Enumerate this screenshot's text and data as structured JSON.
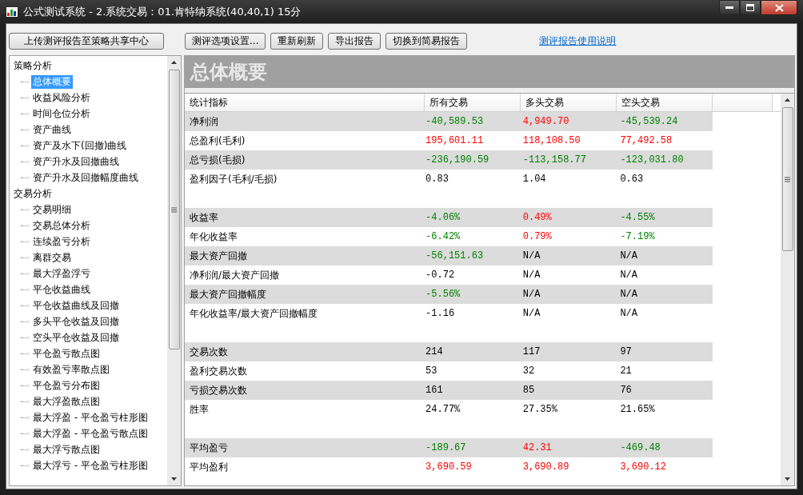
{
  "window": {
    "title": "公式测试系统 - 2.系统交易：01.肯特纳系统(40,40,1) 15分"
  },
  "toolbar": {
    "buttons": [
      {
        "label": "上传测评报告至策略共享中心",
        "kind": "wide"
      },
      {
        "label": "测评选项设置...",
        "kind": "normal"
      },
      {
        "label": "重新刷新",
        "kind": "normal"
      },
      {
        "label": "导出报告",
        "kind": "normal"
      },
      {
        "label": "切换到简易报告",
        "kind": "normal"
      }
    ],
    "link": "测评报告使用说明"
  },
  "tree": [
    {
      "label": "策略分析",
      "children": [
        {
          "label": "总体概要",
          "selected": true
        },
        {
          "label": "收益风险分析",
          "selected": false
        },
        {
          "label": "时间仓位分析",
          "selected": false
        },
        {
          "label": "资产曲线",
          "selected": false
        },
        {
          "label": "资产及水下(回撤)曲线",
          "selected": false
        },
        {
          "label": "资产升水及回撤曲线",
          "selected": false
        },
        {
          "label": "资产升水及回撤幅度曲线",
          "selected": false
        }
      ]
    },
    {
      "label": "交易分析",
      "children": [
        {
          "label": "交易明细",
          "selected": false
        },
        {
          "label": "交易总体分析",
          "selected": false
        },
        {
          "label": "连续盈亏分析",
          "selected": false
        },
        {
          "label": "离群交易",
          "selected": false
        },
        {
          "label": "最大浮盈浮亏",
          "selected": false
        },
        {
          "label": "平仓收益曲线",
          "selected": false
        },
        {
          "label": "平仓收益曲线及回撤",
          "selected": false
        },
        {
          "label": "多头平仓收益及回撤",
          "selected": false
        },
        {
          "label": "空头平仓收益及回撤",
          "selected": false
        },
        {
          "label": "平仓盈亏散点图",
          "selected": false
        },
        {
          "label": "有效盈亏率散点图",
          "selected": false
        },
        {
          "label": "平仓盈亏分布图",
          "selected": false
        },
        {
          "label": "最大浮盈散点图",
          "selected": false
        },
        {
          "label": "最大浮盈 - 平仓盈亏柱形图",
          "selected": false
        },
        {
          "label": "最大浮盈 - 平仓盈亏散点图",
          "selected": false
        },
        {
          "label": "最大浮亏散点图",
          "selected": false
        },
        {
          "label": "最大浮亏 - 平仓盈亏柱形图",
          "selected": false
        }
      ]
    }
  ],
  "section_title": "总体概要",
  "table": {
    "columns": [
      "统计指标",
      "所有交易",
      "多头交易",
      "空头交易"
    ],
    "groups": [
      [
        {
          "label": "净利润",
          "cells": [
            {
              "text": "-40,589.53",
              "color": "#008000"
            },
            {
              "text": "4,949.70",
              "color": "#ff0000"
            },
            {
              "text": "-45,539.24",
              "color": "#008000"
            }
          ]
        },
        {
          "label": "总盈利(毛利)",
          "cells": [
            {
              "text": "195,601.11",
              "color": "#ff0000"
            },
            {
              "text": "118,108.50",
              "color": "#ff0000"
            },
            {
              "text": "77,492.58",
              "color": "#ff0000"
            }
          ]
        },
        {
          "label": "总亏损(毛损)",
          "cells": [
            {
              "text": "-236,190.59",
              "color": "#008000"
            },
            {
              "text": "-113,158.77",
              "color": "#008000"
            },
            {
              "text": "-123,031.80",
              "color": "#008000"
            }
          ]
        },
        {
          "label": "盈利因子(毛利/毛损)",
          "cells": [
            {
              "text": "0.83",
              "color": "#000000"
            },
            {
              "text": "1.04",
              "color": "#000000"
            },
            {
              "text": "0.63",
              "color": "#000000"
            }
          ]
        }
      ],
      [
        {
          "label": "收益率",
          "cells": [
            {
              "text": "-4.06%",
              "color": "#008000"
            },
            {
              "text": "0.49%",
              "color": "#ff0000"
            },
            {
              "text": "-4.55%",
              "color": "#008000"
            }
          ]
        },
        {
          "label": "年化收益率",
          "cells": [
            {
              "text": "-6.42%",
              "color": "#008000"
            },
            {
              "text": "0.79%",
              "color": "#ff0000"
            },
            {
              "text": "-7.19%",
              "color": "#008000"
            }
          ]
        },
        {
          "label": "最大资产回撤",
          "cells": [
            {
              "text": "-56,151.63",
              "color": "#008000"
            },
            {
              "text": "N/A",
              "color": "#000000"
            },
            {
              "text": "N/A",
              "color": "#000000"
            }
          ]
        },
        {
          "label": "净利润/最大资产回撤",
          "cells": [
            {
              "text": "-0.72",
              "color": "#000000"
            },
            {
              "text": "N/A",
              "color": "#000000"
            },
            {
              "text": "N/A",
              "color": "#000000"
            }
          ]
        },
        {
          "label": "最大资产回撤幅度",
          "cells": [
            {
              "text": "-5.56%",
              "color": "#008000"
            },
            {
              "text": "N/A",
              "color": "#000000"
            },
            {
              "text": "N/A",
              "color": "#000000"
            }
          ]
        },
        {
          "label": "年化收益率/最大资产回撤幅度",
          "cells": [
            {
              "text": "-1.16",
              "color": "#000000"
            },
            {
              "text": "N/A",
              "color": "#000000"
            },
            {
              "text": "N/A",
              "color": "#000000"
            }
          ]
        }
      ],
      [
        {
          "label": "交易次数",
          "cells": [
            {
              "text": "214",
              "color": "#000000"
            },
            {
              "text": "117",
              "color": "#000000"
            },
            {
              "text": "97",
              "color": "#000000"
            }
          ]
        },
        {
          "label": "盈利交易次数",
          "cells": [
            {
              "text": "53",
              "color": "#000000"
            },
            {
              "text": "32",
              "color": "#000000"
            },
            {
              "text": "21",
              "color": "#000000"
            }
          ]
        },
        {
          "label": "亏损交易次数",
          "cells": [
            {
              "text": "161",
              "color": "#000000"
            },
            {
              "text": "85",
              "color": "#000000"
            },
            {
              "text": "76",
              "color": "#000000"
            }
          ]
        },
        {
          "label": "胜率",
          "cells": [
            {
              "text": "24.77%",
              "color": "#000000"
            },
            {
              "text": "27.35%",
              "color": "#000000"
            },
            {
              "text": "21.65%",
              "color": "#000000"
            }
          ]
        }
      ],
      [
        {
          "label": "平均盈亏",
          "cells": [
            {
              "text": "-189.67",
              "color": "#008000"
            },
            {
              "text": "42.31",
              "color": "#ff0000"
            },
            {
              "text": "-469.48",
              "color": "#008000"
            }
          ]
        },
        {
          "label": "平均盈利",
          "cells": [
            {
              "text": "3,690.59",
              "color": "#ff0000"
            },
            {
              "text": "3,690.89",
              "color": "#ff0000"
            },
            {
              "text": "3,690.12",
              "color": "#ff0000"
            }
          ]
        }
      ]
    ]
  }
}
